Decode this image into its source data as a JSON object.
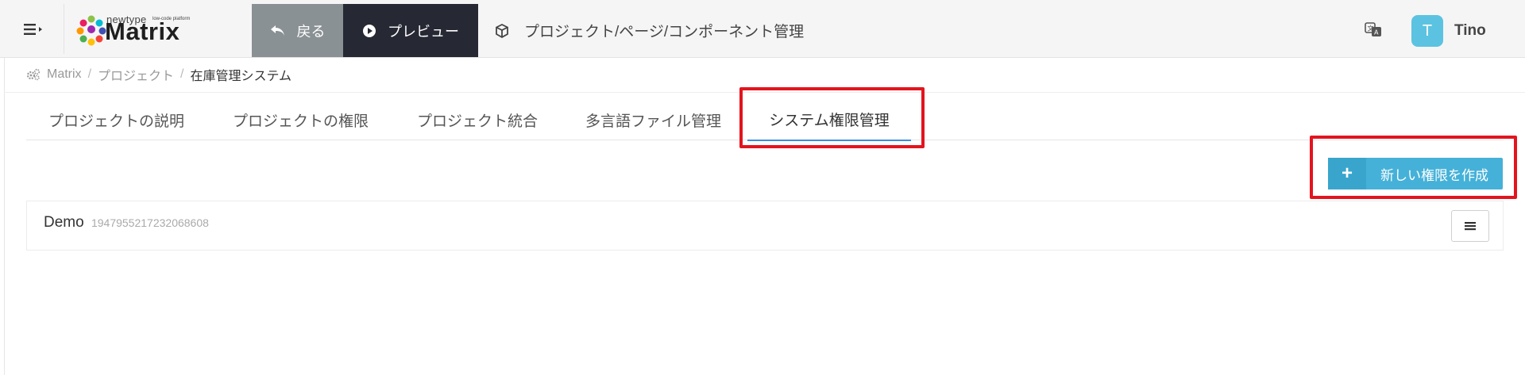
{
  "header": {
    "logo": {
      "brand": "Matrix",
      "tagline": "newtype",
      "subtag": "low-code platform"
    },
    "back_label": "戻る",
    "preview_label": "プレビュー",
    "project_link_label": "プロジェクト/ページ/コンポーネント管理",
    "user": {
      "initial": "T",
      "name": "Tino"
    }
  },
  "breadcrumb": {
    "items": [
      "Matrix",
      "プロジェクト",
      "在庫管理システム"
    ],
    "separator": "/"
  },
  "tabs": [
    {
      "label": "プロジェクトの説明",
      "active": false
    },
    {
      "label": "プロジェクトの権限",
      "active": false
    },
    {
      "label": "プロジェクト統合",
      "active": false
    },
    {
      "label": "多言語ファイル管理",
      "active": false
    },
    {
      "label": "システム権限管理",
      "active": true
    }
  ],
  "actions": {
    "create_label": "新しい権限を作成",
    "create_icon": "plus-icon"
  },
  "permissions": [
    {
      "name": "Demo",
      "id": "1947955217232068608"
    }
  ],
  "colors": {
    "accent": "#45b1d8",
    "back_button": "#8a9194",
    "preview_button": "#262833",
    "active_tab_underline": "#3d8fd8",
    "highlight": "#e3141e",
    "avatar": "#5bc3e1"
  }
}
